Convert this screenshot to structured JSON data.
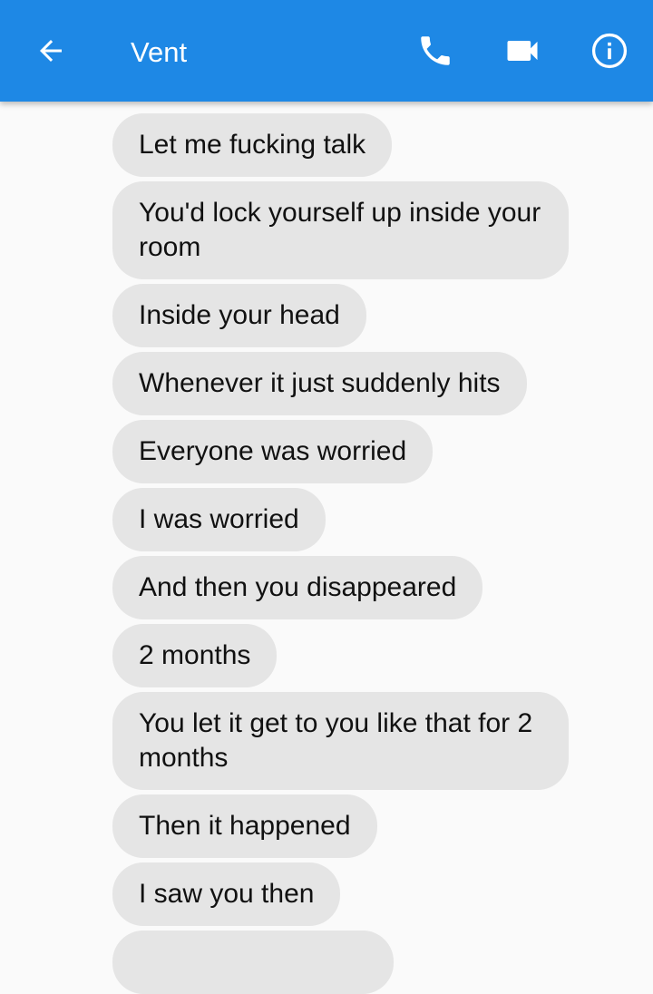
{
  "header": {
    "title": "Vent",
    "background_color": "#1e88e5",
    "icons": {
      "back": "arrow-left-icon",
      "call": "phone-icon",
      "video": "video-camera-icon",
      "info": "info-icon"
    }
  },
  "messages": [
    "Let me fucking talk",
    "You'd lock yourself up inside your room",
    "Inside your head",
    "Whenever it just suddenly hits",
    "Everyone was worried",
    "I was worried",
    "And then you disappeared",
    "2 months",
    "You let it get to you like that for 2 months",
    "Then it happened",
    "I saw you then"
  ],
  "bubble_color": "#e5e5e5"
}
